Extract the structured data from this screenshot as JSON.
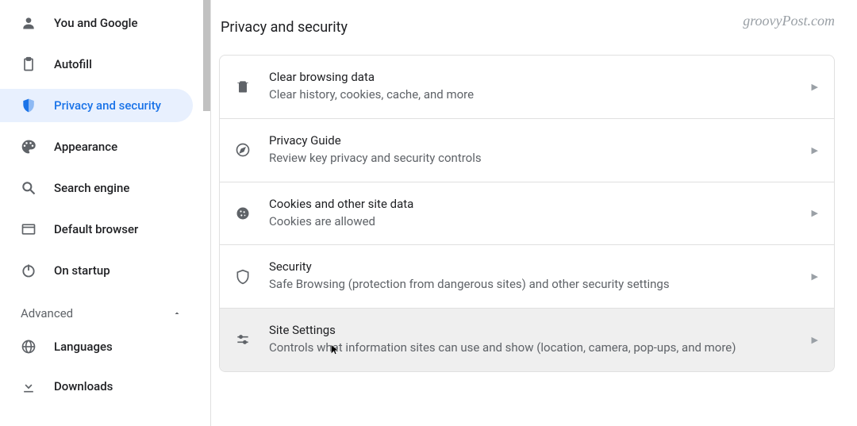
{
  "sidebar": {
    "items": [
      {
        "label": "You and Google"
      },
      {
        "label": "Autofill"
      },
      {
        "label": "Privacy and security"
      },
      {
        "label": "Appearance"
      },
      {
        "label": "Search engine"
      },
      {
        "label": "Default browser"
      },
      {
        "label": "On startup"
      }
    ],
    "advanced_label": "Advanced",
    "advanced_items": [
      {
        "label": "Languages"
      },
      {
        "label": "Downloads"
      }
    ]
  },
  "page": {
    "title": "Privacy and security",
    "watermark": "groovyPost.com"
  },
  "rows": [
    {
      "title": "Clear browsing data",
      "desc": "Clear history, cookies, cache, and more"
    },
    {
      "title": "Privacy Guide",
      "desc": "Review key privacy and security controls"
    },
    {
      "title": "Cookies and other site data",
      "desc": "Cookies are allowed"
    },
    {
      "title": "Security",
      "desc": "Safe Browsing (protection from dangerous sites) and other security settings"
    },
    {
      "title": "Site Settings",
      "desc": "Controls what information sites can use and show (location, camera, pop-ups, and more)"
    }
  ]
}
